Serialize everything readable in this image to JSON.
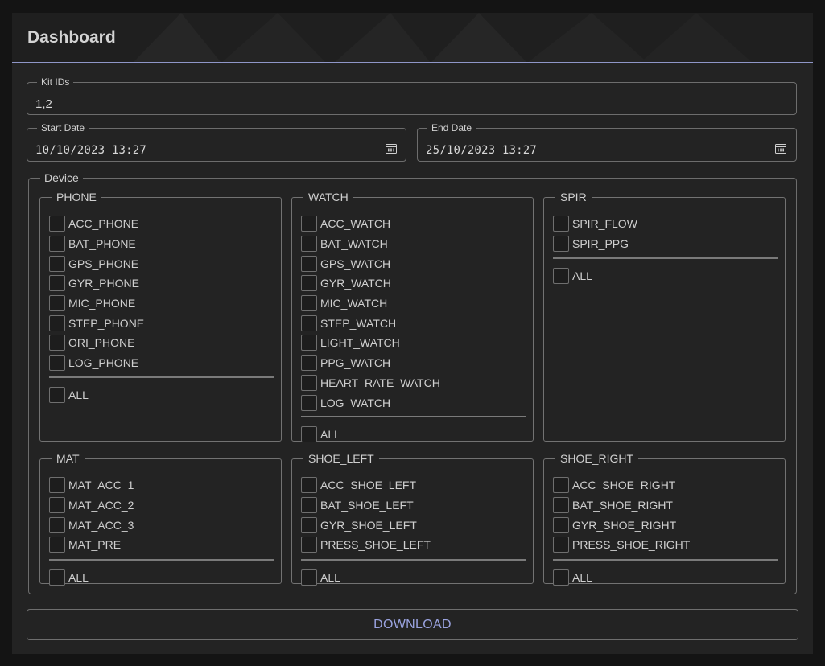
{
  "header": {
    "title": "Dashboard"
  },
  "kit_ids": {
    "label": "Kit IDs",
    "value": "1,2"
  },
  "start_date": {
    "label": "Start Date",
    "value": "10/10/2023 13:27",
    "icon": "calendar-icon"
  },
  "end_date": {
    "label": "End Date",
    "value": "25/10/2023 13:27",
    "icon": "calendar-icon"
  },
  "device": {
    "label": "Device",
    "all_label": "ALL",
    "groups": [
      {
        "name": "PHONE",
        "items": [
          "ACC_PHONE",
          "BAT_PHONE",
          "GPS_PHONE",
          "GYR_PHONE",
          "MIC_PHONE",
          "STEP_PHONE",
          "ORI_PHONE",
          "LOG_PHONE"
        ]
      },
      {
        "name": "WATCH",
        "items": [
          "ACC_WATCH",
          "BAT_WATCH",
          "GPS_WATCH",
          "GYR_WATCH",
          "MIC_WATCH",
          "STEP_WATCH",
          "LIGHT_WATCH",
          "PPG_WATCH",
          "HEART_RATE_WATCH",
          "LOG_WATCH"
        ]
      },
      {
        "name": "SPIR",
        "items": [
          "SPIR_FLOW",
          "SPIR_PPG"
        ]
      },
      {
        "name": "MAT",
        "items": [
          "MAT_ACC_1",
          "MAT_ACC_2",
          "MAT_ACC_3",
          "MAT_PRE"
        ]
      },
      {
        "name": "SHOE_LEFT",
        "items": [
          "ACC_SHOE_LEFT",
          "BAT_SHOE_LEFT",
          "GYR_SHOE_LEFT",
          "PRESS_SHOE_LEFT"
        ]
      },
      {
        "name": "SHOE_RIGHT",
        "items": [
          "ACC_SHOE_RIGHT",
          "BAT_SHOE_RIGHT",
          "GYR_SHOE_RIGHT",
          "PRESS_SHOE_RIGHT"
        ]
      }
    ]
  },
  "download": {
    "label": "DOWNLOAD"
  },
  "colors": {
    "accent": "#9aa3e0",
    "background": "#232323",
    "header_line": "#8f96c8"
  }
}
